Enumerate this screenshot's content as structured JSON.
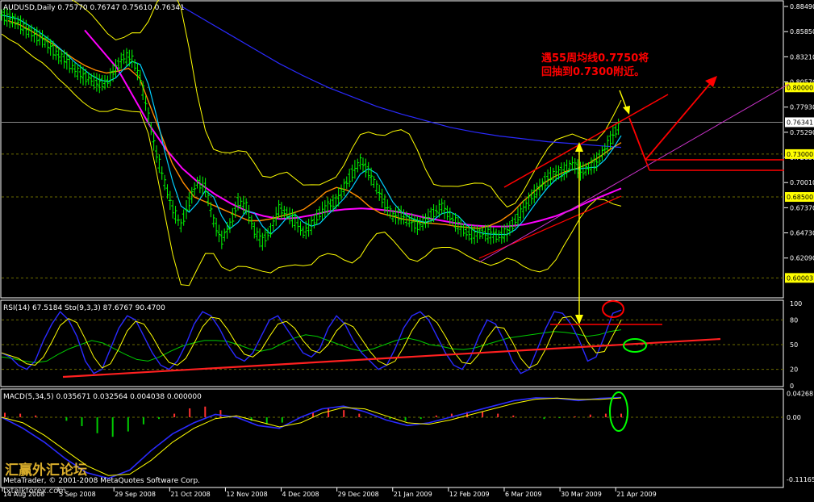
{
  "header": {
    "main_title": "AUDUSD,Daily  0.75770 0.76747 0.75610 0.76341",
    "rsi_title": "RSI(14) 67.5184  Sto(9,3,3) 87.6767 90.4700",
    "macd_title": "MACD(5,34,5) 0.035671 0.032564 0.004038 0.000000"
  },
  "annotation": {
    "line1": "遇55周均线0.7750将",
    "line2": "回抽到0.7300附近。"
  },
  "watermark": {
    "logo_text": "汇赢外汇论坛",
    "copyright": "MetaTrader, © 2001-2008 MetaQuotes Software Corp.",
    "site": "fxtalkforex.com"
  },
  "colors": {
    "background": "#000000",
    "grid": "#6b6b00",
    "candle": "#00ff00",
    "axis_text": "#ffffff",
    "price_flag": "#ffff00",
    "annotation": "#ff0000",
    "ma_fast": "#00d0ff",
    "ma_mid": "#ff8c00",
    "ma_long": "#ff00ff",
    "ma_200": "#2a2aff",
    "bollinger": "#ffff00",
    "stoch": "#2a2aff",
    "rsi": "#00cc00"
  },
  "chart_data": [
    {
      "type": "candlestick",
      "symbol": "AUDUSD",
      "timeframe": "Daily",
      "current_price": 0.76341,
      "ylim": [
        0.58,
        0.89
      ],
      "y_ticks": [
        "0.88490",
        "0.85850",
        "0.83210",
        "0.80570",
        "0.77930",
        "0.75290",
        "0.72650",
        "0.70010",
        "0.67370",
        "0.64730",
        "0.62090"
      ],
      "highlighted_levels": [
        "0.80000",
        "0.76341",
        "0.73000",
        "0.68500",
        "0.60003"
      ],
      "x_ticks": [
        "14 Aug 2008",
        "5 Sep 2008",
        "29 Sep 2008",
        "21 Oct 2008",
        "12 Nov 2008",
        "4 Dec 2008",
        "29 Dec 2008",
        "21 Jan 2009",
        "12 Feb 2009",
        "6 Mar 2009",
        "30 Mar 2009",
        "21 Apr 2009"
      ],
      "series": [
        {
          "values": [
            0.876,
            0.872,
            0.868,
            0.861,
            0.855,
            0.851,
            0.842,
            0.833,
            0.828,
            0.818,
            0.812,
            0.808,
            0.804,
            0.806,
            0.82,
            0.832,
            0.83,
            0.81,
            0.77,
            0.73,
            0.7,
            0.672,
            0.655,
            0.68,
            0.7,
            0.695,
            0.66,
            0.64,
            0.655,
            0.68,
            0.675,
            0.65,
            0.638,
            0.65,
            0.672,
            0.668,
            0.66,
            0.648,
            0.655,
            0.668,
            0.675,
            0.68,
            0.695,
            0.71,
            0.722,
            0.712,
            0.695,
            0.678,
            0.665,
            0.666,
            0.66,
            0.655,
            0.66,
            0.668,
            0.675,
            0.665,
            0.655,
            0.648,
            0.645,
            0.648,
            0.645,
            0.644,
            0.648,
            0.66,
            0.672,
            0.685,
            0.695,
            0.705,
            0.71,
            0.712,
            0.72,
            0.712,
            0.715,
            0.722,
            0.735,
            0.75,
            0.763
          ]
        },
        {
          "name": "",
          "values": [
            0.87,
            0.866,
            0.86,
            0.853,
            0.846,
            0.838,
            0.83,
            0.823,
            0.818,
            0.815,
            0.817,
            0.82,
            0.81,
            0.78,
            0.75,
            0.72,
            0.7,
            0.685,
            0.68,
            0.675,
            0.67,
            0.665,
            0.66,
            0.66,
            0.662,
            0.665,
            0.668,
            0.672,
            0.68,
            0.69,
            0.695,
            0.692,
            0.685,
            0.675,
            0.668,
            0.665,
            0.662,
            0.66,
            0.658,
            0.657,
            0.656,
            0.654,
            0.653,
            0.652,
            0.655,
            0.66,
            0.668,
            0.68,
            0.69,
            0.7,
            0.707,
            0.712,
            0.715,
            0.72,
            0.727,
            0.735,
            0.742
          ]
        },
        {
          "name": "",
          "values": [
            0.86,
            0.84,
            0.82,
            0.79,
            0.76,
            0.735,
            0.715,
            0.7,
            0.688,
            0.678,
            0.67,
            0.665,
            0.662,
            0.663,
            0.666,
            0.67,
            0.672,
            0.673,
            0.672,
            0.67,
            0.667,
            0.663,
            0.66,
            0.657,
            0.655,
            0.654,
            0.654,
            0.656,
            0.66,
            0.665,
            0.672,
            0.68,
            0.687,
            0.694
          ]
        },
        {
          "name": "",
          "values": [
            0.885,
            0.87,
            0.855,
            0.84,
            0.825,
            0.812,
            0.8,
            0.79,
            0.78,
            0.772,
            0.765,
            0.758,
            0.753,
            0.749,
            0.746,
            0.743,
            0.741,
            0.739,
            0.737
          ]
        },
        {
          "name": "Stoch(9,3,3)",
          "values": [
            40,
            35,
            25,
            20,
            30,
            55,
            75,
            90,
            80,
            60,
            30,
            15,
            20,
            45,
            70,
            85,
            80,
            60,
            40,
            25,
            20,
            30,
            50,
            75,
            90,
            85,
            70,
            50,
            35,
            30,
            40,
            60,
            80,
            85,
            70,
            55,
            40,
            35,
            45,
            70,
            85,
            75,
            55,
            40,
            30,
            20,
            25,
            45,
            70,
            85,
            90,
            80,
            60,
            40,
            25,
            20,
            35,
            60,
            80,
            75,
            55,
            30,
            15,
            20,
            45,
            70,
            90,
            88,
            75,
            55,
            30,
            35,
            60,
            88,
            92
          ]
        },
        {
          "name": "RSI(14)",
          "values": [
            35,
            33,
            30,
            28,
            30,
            38,
            45,
            50,
            55,
            52,
            45,
            38,
            32,
            30,
            35,
            42,
            48,
            52,
            55,
            55,
            54,
            50,
            45,
            42,
            45,
            52,
            58,
            62,
            60,
            55,
            50,
            45,
            42,
            45,
            50,
            55,
            58,
            55,
            50,
            48,
            45,
            44,
            46,
            50,
            54,
            58,
            60,
            62,
            64,
            66,
            65,
            63,
            60,
            62,
            66,
            68
          ]
        },
        {
          "name": "MACD histogram",
          "values": [
            0.005,
            0.004,
            0.002,
            0.0,
            -0.004,
            -0.01,
            -0.018,
            -0.022,
            -0.016,
            -0.008,
            -0.002,
            0.004,
            0.01,
            0.012,
            0.008,
            0.002,
            -0.004,
            -0.008,
            -0.006,
            0.0,
            0.006,
            0.01,
            0.008,
            0.004,
            0.0,
            -0.002,
            -0.004,
            -0.002,
            0.002,
            0.004,
            0.006,
            0.006,
            0.004,
            0.002,
            0.0,
            -0.002,
            -0.001,
            0.001,
            0.003,
            0.004,
            0.004
          ]
        },
        {
          "name": "MACD",
          "values": [
            0.0,
            -0.02,
            -0.045,
            -0.075,
            -0.1,
            -0.11,
            -0.095,
            -0.06,
            -0.03,
            -0.01,
            0.005,
            0.0,
            -0.015,
            -0.02,
            0.0,
            0.015,
            0.02,
            0.01,
            -0.005,
            -0.015,
            -0.01,
            0.0,
            0.01,
            0.02,
            0.03,
            0.035,
            0.034,
            0.03,
            0.034,
            0.0356
          ]
        }
      ]
    }
  ]
}
